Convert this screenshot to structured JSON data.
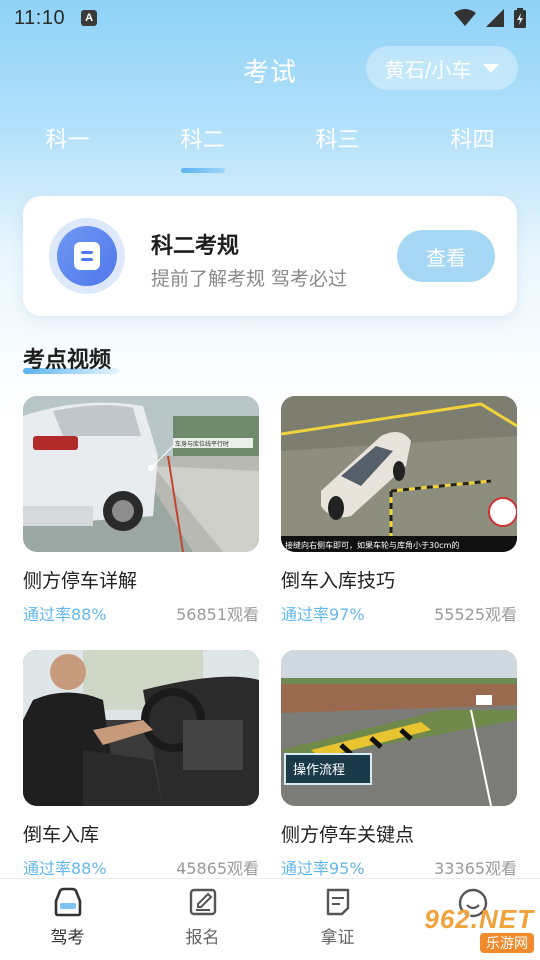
{
  "status": {
    "time": "11:10",
    "a_badge": "A"
  },
  "header": {
    "title": "考试",
    "city": "黄石/小车"
  },
  "tabs": [
    {
      "label": "科一",
      "active": false
    },
    {
      "label": "科二",
      "active": true
    },
    {
      "label": "科三",
      "active": false
    },
    {
      "label": "科四",
      "active": false
    }
  ],
  "rules_card": {
    "title": "科二考规",
    "subtitle": "提前了解考规 驾考必过",
    "button": "查看"
  },
  "section": {
    "title": "考点视频"
  },
  "videos": [
    {
      "title": "侧方停车详解",
      "pass_rate": "通过率88%",
      "views": "56851观看",
      "overlay": "车身与库位线平行时"
    },
    {
      "title": "倒车入库技巧",
      "pass_rate": "通过率97%",
      "views": "55525观看",
      "overlay": "接缝向右侧车即可，如果车轮与库角小于30cm的"
    },
    {
      "title": "倒车入库",
      "pass_rate": "通过率88%",
      "views": "45865观看"
    },
    {
      "title": "侧方停车关键点",
      "pass_rate": "通过率95%",
      "views": "33365观看",
      "overlay": "操作流程"
    }
  ],
  "bottom_nav": [
    {
      "label": "驾考",
      "icon": "car-icon",
      "active": true
    },
    {
      "label": "报名",
      "icon": "edit-icon",
      "active": false
    },
    {
      "label": "拿证",
      "icon": "certificate-icon",
      "active": false
    },
    {
      "label": "",
      "icon": "smile-icon",
      "active": false
    }
  ],
  "watermark": {
    "number": "962.NET",
    "text": "乐游网"
  },
  "colors": {
    "accent": "#63b8ee",
    "button": "#a6d8f6",
    "card_icon": "#4f78ea"
  }
}
